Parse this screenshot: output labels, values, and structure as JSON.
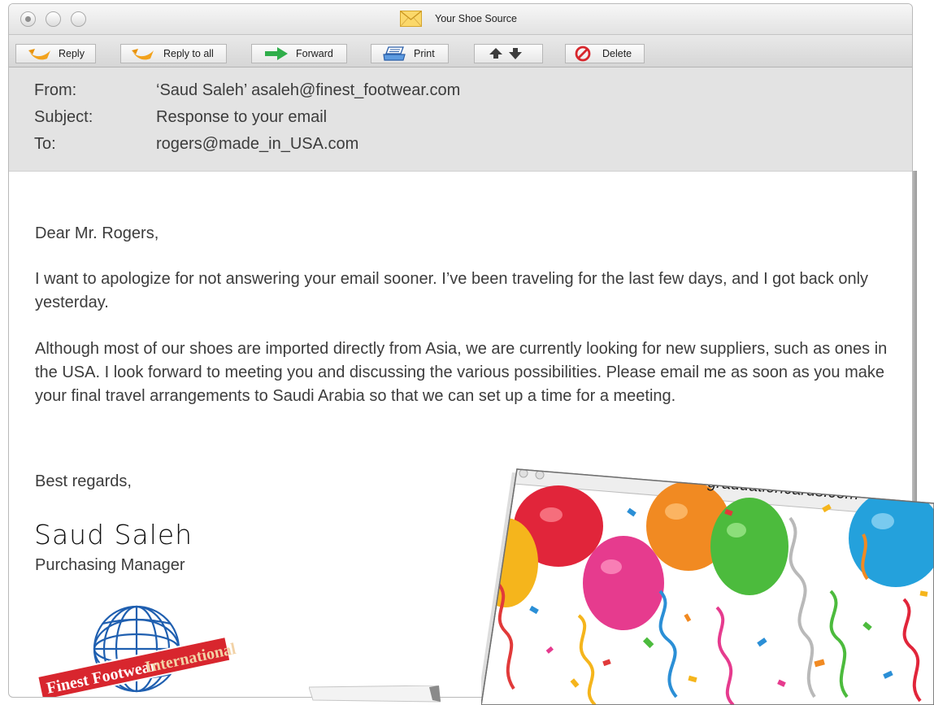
{
  "window": {
    "title": "Your Shoe Source"
  },
  "toolbar": {
    "reply": "Reply",
    "reply_all": "Reply to all",
    "forward": "Forward",
    "print": "Print",
    "delete": "Delete"
  },
  "header": {
    "from_label": "From:",
    "from_value": "‘Saud Saleh’ asaleh@finest_footwear.com",
    "subject_label": "Subject:",
    "subject_value": "Response to your email",
    "to_label": "To:",
    "to_value": "rogers@made_in_USA.com"
  },
  "message": {
    "greeting": "Dear Mr. Rogers,",
    "para1": "I want to apologize for not answering your email sooner. I’ve been traveling for the last few days, and I got back only yesterday.",
    "para2": "Although most of our shoes are imported directly from Asia, we are currently looking for new suppliers, such as ones in the USA. I look forward to meeting you and discussing the various possibilities. Please email me as soon as you make your final travel arrangements to Saudi Arabia so that we can set up a time for a meeting.",
    "closing": "Best regards,",
    "signature": "Saud Saleh",
    "signer_title": "Purchasing Manager"
  },
  "logo": {
    "text_red": "Finest Footwear",
    "text_white": "International",
    "colors": {
      "globe": "#1f5fb0",
      "banner": "#d8262e"
    }
  },
  "popup": {
    "url": "graduationcards.com"
  },
  "icons": {
    "reply": "reply-arrow-icon",
    "reply_all": "reply-all-arrow-icon",
    "forward": "forward-arrow-icon",
    "print": "printer-icon",
    "delete": "prohibited-icon",
    "title": "envelope-icon"
  },
  "colors": {
    "reply_arrow": "#f2a21c",
    "forward_arrow": "#2fae4a",
    "delete_icon": "#d7262c",
    "header_bg": "#e3e3e3"
  }
}
